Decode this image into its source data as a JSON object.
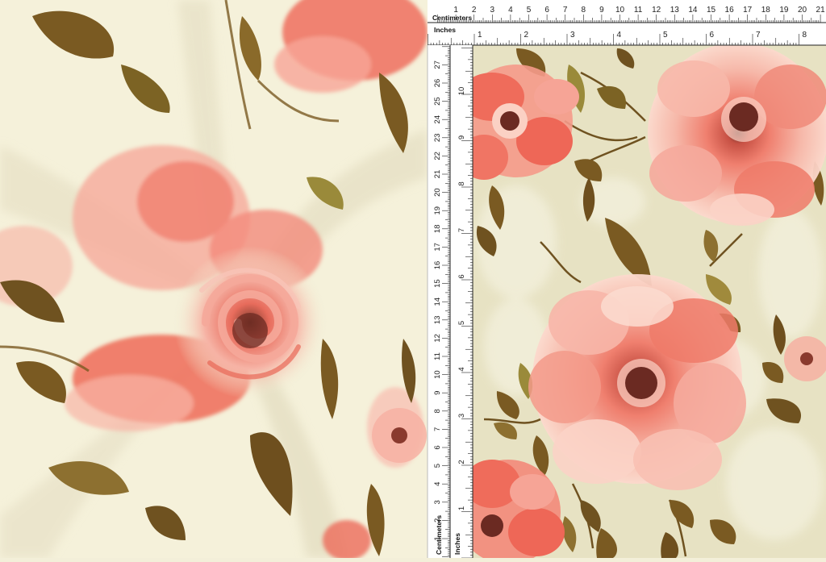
{
  "rulers": {
    "top_cm_label": "Centimeters",
    "top_in_label": "Inches",
    "side_cm_label": "Centimeters",
    "side_in_label": "Inches",
    "cm_numbers": [
      "1",
      "2",
      "3",
      "4",
      "5",
      "6",
      "7",
      "8",
      "9",
      "10",
      "11",
      "12",
      "13",
      "14",
      "15",
      "16",
      "17",
      "18",
      "19",
      "20",
      "21"
    ],
    "in_numbers": [
      "1",
      "2",
      "3",
      "4",
      "5",
      "6",
      "7",
      "8"
    ],
    "side_cm_numbers": [
      "1",
      "2",
      "3",
      "4",
      "5",
      "6",
      "7",
      "8",
      "9",
      "10",
      "11",
      "12",
      "13",
      "14",
      "15",
      "16",
      "17",
      "18",
      "19",
      "20",
      "21",
      "22",
      "23",
      "24",
      "25",
      "26",
      "27"
    ],
    "side_in_numbers": [
      "1",
      "2",
      "3",
      "4",
      "5",
      "6",
      "7",
      "8",
      "9",
      "10"
    ]
  },
  "colors": {
    "fabric_cream": "#f4f0d8",
    "swatch_beige": "#e6e1c2",
    "petal_coral": "#ef6a5a",
    "petal_pink": "#f4a79a",
    "petal_light": "#fbd3c6",
    "flower_center": "#6b2a22",
    "leaf_brown": "#7a5a22",
    "leaf_olive": "#a08a3c",
    "ruler_bg": "#ffffff",
    "ruler_ink": "#222222"
  }
}
